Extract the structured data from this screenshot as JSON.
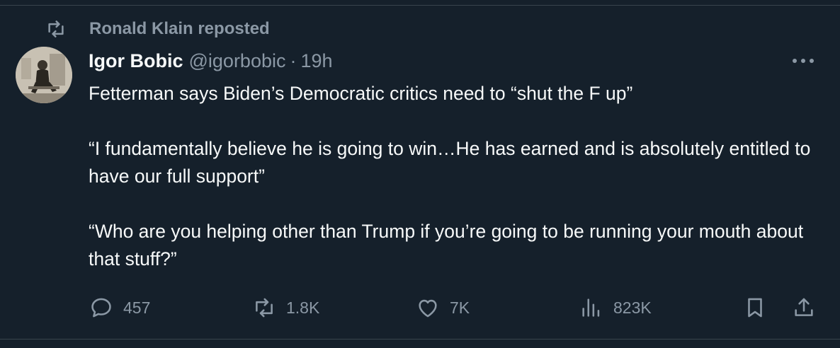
{
  "repost": {
    "label": "Ronald Klain reposted"
  },
  "tweet": {
    "author_name": "Igor Bobic",
    "author_handle": "@igorbobic",
    "separator": "·",
    "time": "19h",
    "paragraphs": [
      "Fetterman says Biden’s Democratic critics need to “shut the F up”",
      "“I fundamentally believe he is going to win…He has earned and is absolutely entitled to have our full support”",
      "“Who are you helping other than Trump if you’re going to be running your mouth about that stuff?”"
    ]
  },
  "actions": {
    "replies": "457",
    "reposts": "1.8K",
    "likes": "7K",
    "views": "823K"
  },
  "icons": {
    "repost": "repost-icon",
    "more": "more-icon",
    "reply": "reply-icon",
    "like": "heart-icon",
    "views": "views-icon",
    "bookmark": "bookmark-icon",
    "share": "share-icon"
  },
  "colors": {
    "background": "#15202b",
    "text": "#f7f9f9",
    "muted": "#8b98a5",
    "divider": "#38444d"
  }
}
